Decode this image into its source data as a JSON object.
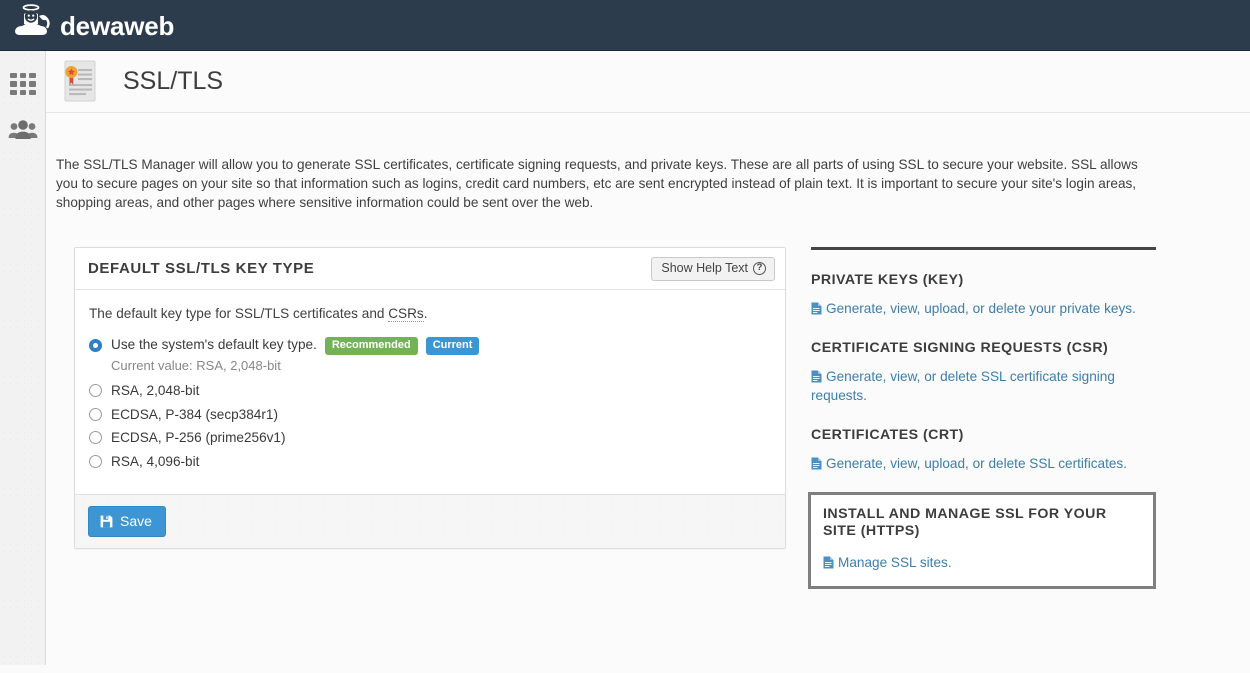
{
  "brand": {
    "name": "dewaweb",
    "logo_icon": "angel-cloud-logo"
  },
  "rail": {
    "items": [
      {
        "icon": "grid-apps-icon",
        "name": "apps"
      },
      {
        "icon": "users-group-icon",
        "name": "users"
      }
    ]
  },
  "page": {
    "title": "SSL/TLS",
    "icon": "certificate-icon",
    "intro": "The SSL/TLS Manager will allow you to generate SSL certificates, certificate signing requests, and private keys. These are all parts of using SSL to secure your website. SSL allows you to secure pages on your site so that information such as logins, credit card numbers, etc are sent encrypted instead of plain text. It is important to secure your site's login areas, shopping areas, and other pages where sensitive information could be sent over the web."
  },
  "panel": {
    "title": "DEFAULT SSL/TLS KEY TYPE",
    "help_button": {
      "label": "Show Help Text",
      "icon": "question-circle-icon"
    },
    "lead_prefix": "The default key type for SSL/TLS certificates and ",
    "lead_abbr": "CSRs",
    "lead_suffix": ".",
    "default_option": {
      "label": "Use the system's default key type.",
      "badges": [
        {
          "text": "Recommended",
          "color": "#73b355"
        },
        {
          "text": "Current",
          "color": "#3b97d3"
        }
      ],
      "current_value": "Current value: RSA, 2,048-bit",
      "selected": true
    },
    "options": [
      {
        "label": "RSA, 2,048-bit",
        "selected": false
      },
      {
        "label": "ECDSA, P-384 (secp384r1)",
        "selected": false
      },
      {
        "label": "ECDSA, P-256 (prime256v1)",
        "selected": false
      },
      {
        "label": "RSA, 4,096-bit",
        "selected": false
      }
    ],
    "save_button": {
      "label": "Save",
      "icon": "floppy-save-icon",
      "color": "#3d96d2"
    }
  },
  "sidebar_sections": [
    {
      "title": "PRIVATE KEYS (KEY)",
      "link": "Generate, view, upload, or delete your private keys.",
      "icon": "document-icon",
      "highlighted": false
    },
    {
      "title": "CERTIFICATE SIGNING REQUESTS (CSR)",
      "link": "Generate, view, or delete SSL certificate signing requests.",
      "icon": "document-icon",
      "highlighted": false
    },
    {
      "title": "CERTIFICATES (CRT)",
      "link": "Generate, view, upload, or delete SSL certificates.",
      "icon": "document-icon",
      "highlighted": false
    },
    {
      "title": "INSTALL AND MANAGE SSL FOR YOUR SITE (HTTPS)",
      "link": "Manage SSL sites.",
      "icon": "document-icon",
      "highlighted": true
    }
  ],
  "colors": {
    "header_bg": "#2d3c4d",
    "link": "#3d7eaa",
    "accent_blue": "#3d96d2",
    "badge_green": "#73b355",
    "highlight_border": "#7f7f7f"
  }
}
